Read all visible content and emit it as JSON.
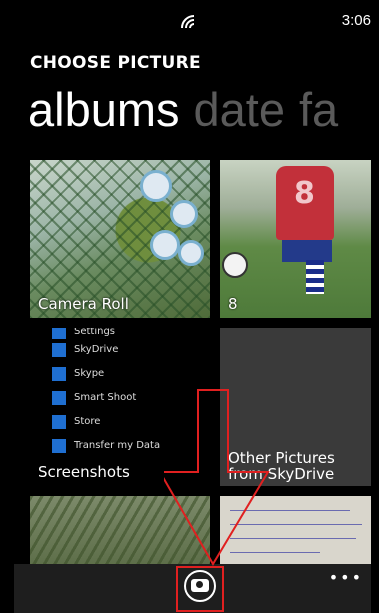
{
  "status": {
    "time": "3:06"
  },
  "header": {
    "title": "CHOOSE PICTURE"
  },
  "pivot": {
    "items": [
      "albums",
      "date",
      "fa"
    ]
  },
  "tiles": {
    "camera_roll": {
      "label": "Camera Roll"
    },
    "count": {
      "label": "8"
    },
    "screenshots": {
      "label": "Screenshots"
    },
    "other": {
      "line1": "Other Pictures",
      "line2": "from SkyDrive"
    }
  },
  "screenshot_preview_items": [
    "Settings",
    "SkyDrive",
    "Skype",
    "Smart Shoot",
    "Store",
    "Transfer my Data"
  ],
  "icons": {
    "signal": "wifi-signal-icon",
    "camera": "camera-icon",
    "more": "ellipsis-icon"
  },
  "colors": {
    "accent": "#1f6fd1",
    "annotation": "#e02020"
  }
}
